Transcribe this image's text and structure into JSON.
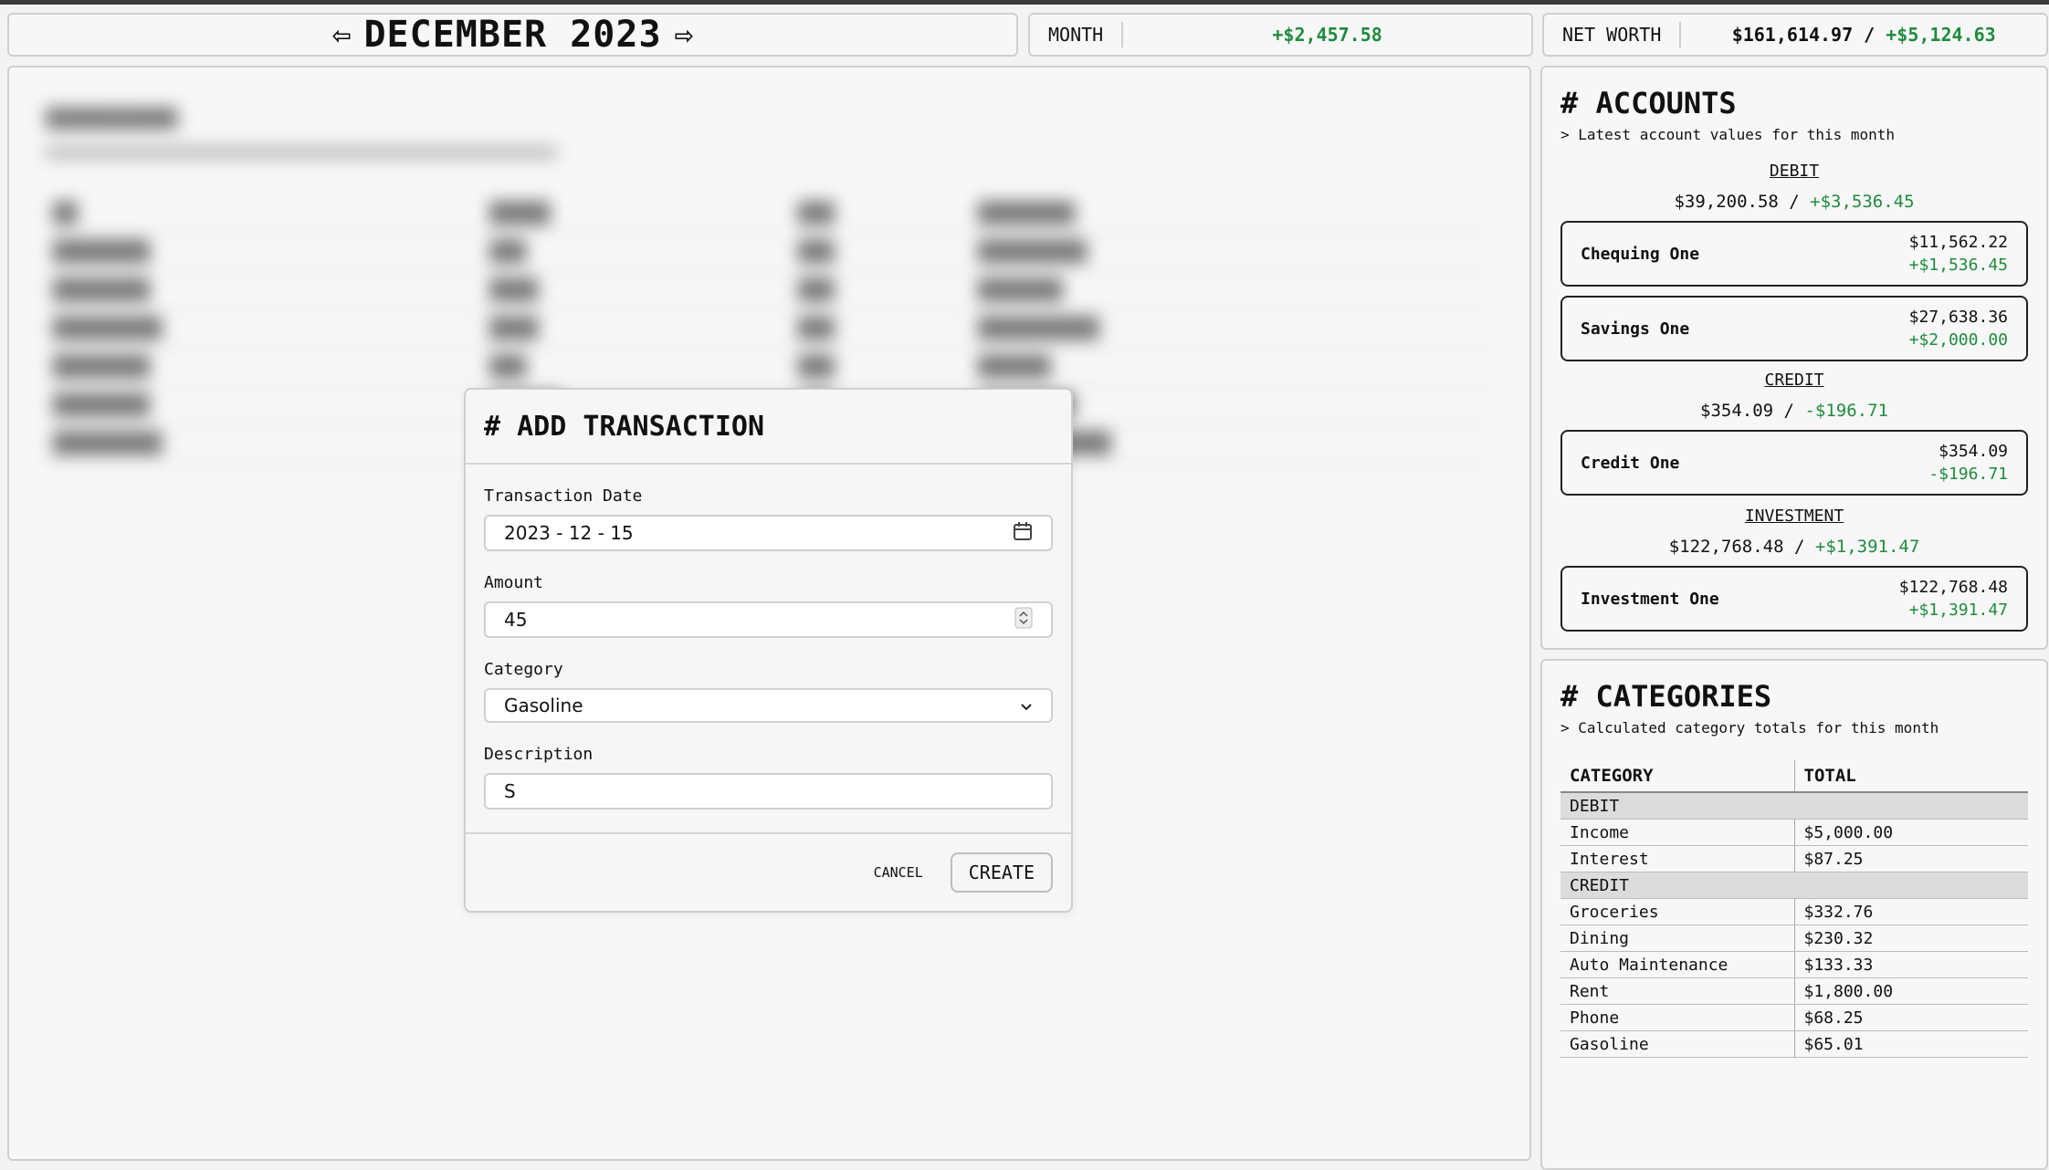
{
  "header": {
    "month_title": "DECEMBER 2023",
    "prev_arrow": "⇦",
    "next_arrow": "⇨",
    "month_label": "MONTH",
    "month_value": "+$2,457.58",
    "networth_label": "NET WORTH",
    "networth_total": "$161,614.97",
    "networth_separator": " / ",
    "networth_change": "+$5,124.63"
  },
  "modal": {
    "title": "# ADD TRANSACTION",
    "date_label": "Transaction Date",
    "date_value": "2023 - 12 - 15",
    "amount_label": "Amount",
    "amount_value": "45",
    "category_label": "Category",
    "category_value": "Gasoline",
    "description_label": "Description",
    "description_value": "S",
    "cancel_label": "CANCEL",
    "create_label": "CREATE"
  },
  "accounts": {
    "title": "# ACCOUNTS",
    "subtitle": "> Latest account values for this month",
    "groups": [
      {
        "label": "DEBIT",
        "total": "$39,200.58",
        "change": "+$3,536.45",
        "items": [
          {
            "name": "Chequing One",
            "value": "$11,562.22",
            "change": "+$1,536.45"
          },
          {
            "name": "Savings One",
            "value": "$27,638.36",
            "change": "+$2,000.00"
          }
        ]
      },
      {
        "label": "CREDIT",
        "total": "$354.09",
        "change": "-$196.71",
        "items": [
          {
            "name": "Credit One",
            "value": "$354.09",
            "change": "-$196.71"
          }
        ]
      },
      {
        "label": "INVESTMENT",
        "total": "$122,768.48",
        "change": "+$1,391.47",
        "items": [
          {
            "name": "Investment One",
            "value": "$122,768.48",
            "change": "+$1,391.47"
          }
        ]
      }
    ]
  },
  "categories": {
    "title": "# CATEGORIES",
    "subtitle": "> Calculated category totals for this month",
    "col_category": "CATEGORY",
    "col_total": "TOTAL",
    "debit_label": "DEBIT",
    "debit_rows": [
      {
        "name": "Income",
        "total": "$5,000.00"
      },
      {
        "name": "Interest",
        "total": "$87.25"
      }
    ],
    "credit_label": "CREDIT",
    "credit_rows": [
      {
        "name": "Groceries",
        "total": "$332.76"
      },
      {
        "name": "Dining",
        "total": "$230.32"
      },
      {
        "name": "Auto Maintenance",
        "total": "$133.33"
      },
      {
        "name": "Rent",
        "total": "$1,800.00"
      },
      {
        "name": "Phone",
        "total": "$68.25"
      },
      {
        "name": "Gasoline",
        "total": "$65.01"
      }
    ]
  },
  "colors": {
    "positive": "#1f8b3f",
    "border": "#cfcfcf"
  },
  "icons": {
    "date": "calendar-icon",
    "amount": "stepper-icon",
    "category": "chevron-down-icon"
  }
}
